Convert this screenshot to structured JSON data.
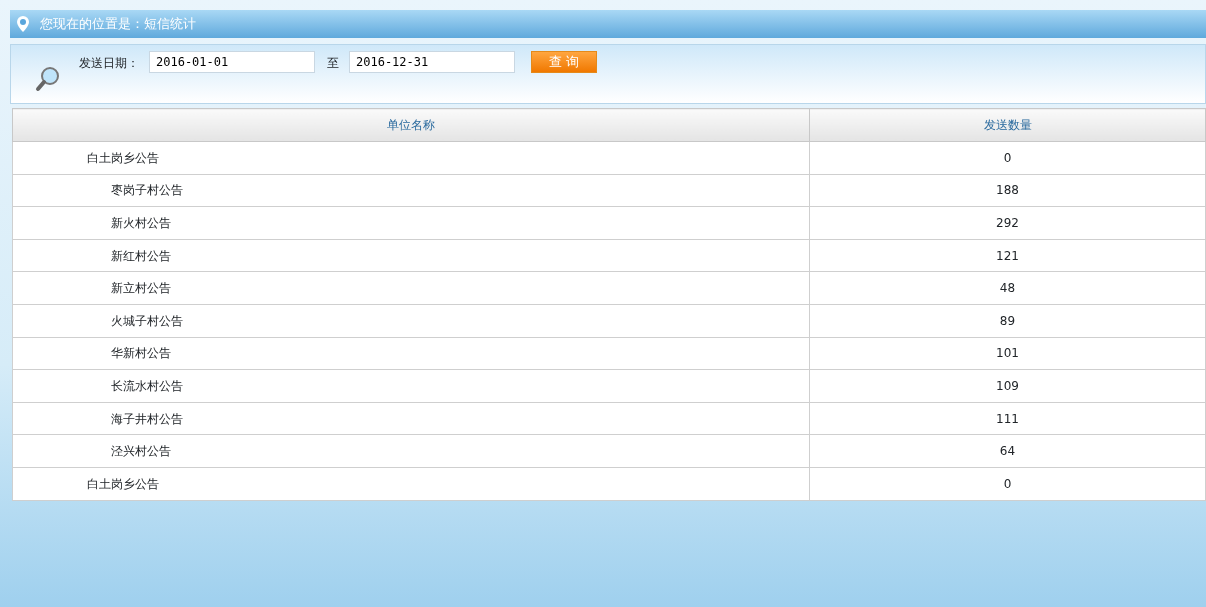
{
  "breadcrumb": {
    "label": "您现在的位置是：",
    "current": "短信统计"
  },
  "search": {
    "date_label": "发送日期：",
    "start_date": "2016-01-01",
    "separator": "至",
    "end_date": "2016-12-31",
    "button": "查 询"
  },
  "table": {
    "columns": [
      "单位名称",
      "发送数量"
    ],
    "rows": [
      {
        "name": "白土岗乡公告",
        "count": "0",
        "children": [
          {
            "name": "枣岗子村公告",
            "count": "188"
          },
          {
            "name": "新火村公告",
            "count": "292"
          },
          {
            "name": "新红村公告",
            "count": "121"
          },
          {
            "name": "新立村公告",
            "count": "48"
          },
          {
            "name": "火城子村公告",
            "count": "89"
          },
          {
            "name": "华新村公告",
            "count": "101"
          },
          {
            "name": "长流水村公告",
            "count": "109"
          },
          {
            "name": "海子井村公告",
            "count": "111"
          },
          {
            "name": "泾兴村公告",
            "count": "64"
          }
        ]
      },
      {
        "name": "白土岗乡公告",
        "count": "0"
      }
    ]
  }
}
